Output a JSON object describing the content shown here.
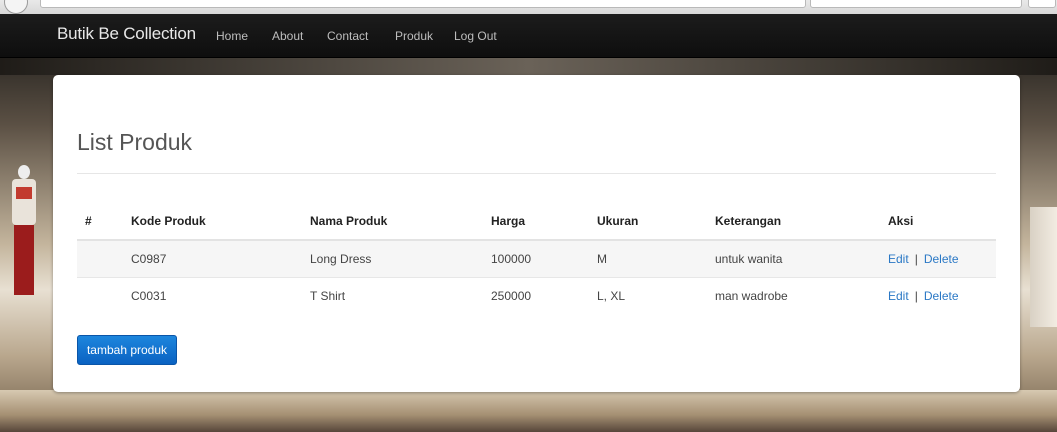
{
  "navbar": {
    "brand": "Butik Be Collection",
    "items": [
      "Home",
      "About",
      "Contact",
      "Produk",
      "Log Out"
    ]
  },
  "main": {
    "title": "List Produk",
    "table": {
      "headers": [
        "#",
        "Kode Produk",
        "Nama Produk",
        "Harga",
        "Ukuran",
        "Keterangan",
        "Aksi"
      ],
      "rows": [
        {
          "num": "",
          "kode": "C0987",
          "nama": "Long Dress",
          "harga": "100000",
          "ukuran": "M",
          "keterangan": "untuk wanita",
          "edit": "Edit",
          "sep": "|",
          "delete": "Delete"
        },
        {
          "num": "",
          "kode": "C0031",
          "nama": "T Shirt",
          "harga": "250000",
          "ukuran": "L, XL",
          "keterangan": "man wadrobe",
          "edit": "Edit",
          "sep": "|",
          "delete": "Delete"
        }
      ]
    },
    "add_button": "tambah produk"
  },
  "colors": {
    "navbar": "#111111",
    "link": "#2a78c5",
    "button": "#0a62c2"
  }
}
